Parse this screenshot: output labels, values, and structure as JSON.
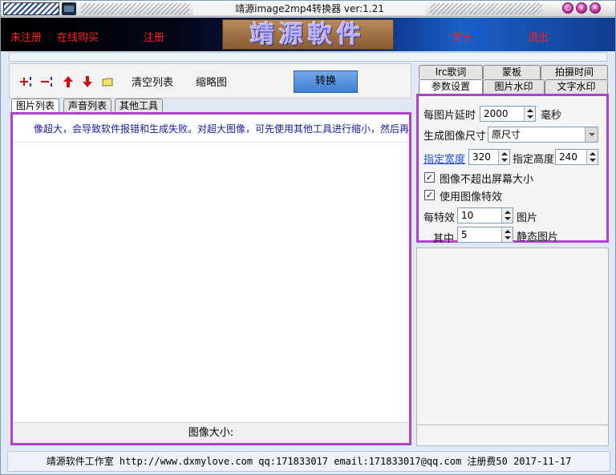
{
  "window": {
    "title": "靖源image2mp4转换器 ver:1.21",
    "buttons": [
      "○",
      "∨",
      "✕"
    ]
  },
  "banner": {
    "unregistered": "未注册",
    "buy_online": "在线购买",
    "register": "注册",
    "logo_text": "靖源軟件",
    "about": "关于",
    "exit": "退出"
  },
  "toolbar": {
    "clear_list": "清空列表",
    "thumbnail": "缩略图",
    "convert": "转换"
  },
  "left_tabs": {
    "images": "图片列表",
    "sounds": "声音列表",
    "other_tools": "其他工具"
  },
  "image_list": {
    "notice": "像超大，会导致软件报错和生成失败。对超大图像，可先使用其他工具进行缩小，然后再",
    "image_size_label": "图像大小:"
  },
  "right_tabs": {
    "lrc": "lrc歌词",
    "mask": "蒙板",
    "shoot_time": "拍摄时间",
    "params": "参数设置",
    "image_watermark": "图片水印",
    "text_watermark": "文字水印"
  },
  "settings": {
    "delay_label": "每图片延时",
    "delay_value": "2000",
    "delay_unit": "毫秒",
    "output_size_label": "生成图像尺寸",
    "output_size_value": "原尺寸",
    "width_label": "指定宽度",
    "width_value": "320",
    "height_label": "指定高度",
    "height_value": "240",
    "no_exceed_screen": "图像不超出屏幕大小",
    "use_effects": "使用图像特效",
    "per_effect_label": "每特效",
    "per_effect_value": "10",
    "per_effect_unit": "图片",
    "among_label": "其中",
    "among_value": "5",
    "among_unit": "静态图片",
    "check_mark": "✓"
  },
  "statusbar": {
    "text": "靖源软件工作室 http://www.dxmylove.com qq:171833017 email:171833017@qq.com 注册费50 2017-11-17"
  }
}
